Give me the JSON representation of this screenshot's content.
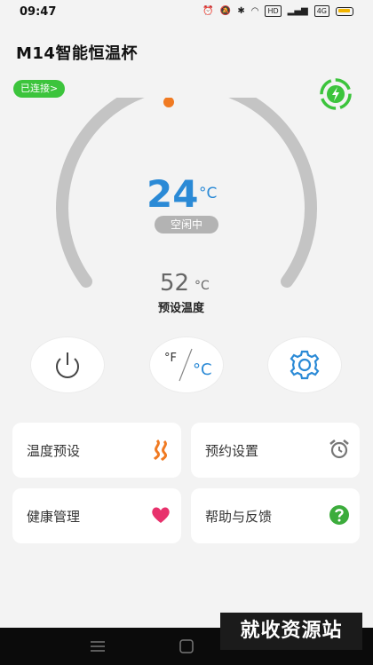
{
  "status_bar": {
    "time": "09:47",
    "hd_label": "HD",
    "net_label": "4G"
  },
  "header": {
    "title": "M14智能恒温杯",
    "connection_label": "已连接>"
  },
  "gauge": {
    "current_temp": "24",
    "current_unit": "°C",
    "state": "空闲中",
    "preset_temp": "52",
    "preset_unit": "°C",
    "preset_label": "预设温度",
    "indicator_color": "#f07a22",
    "track_color": "#c4c4c4"
  },
  "controls": {
    "unit_f": "°F",
    "unit_c": "°C"
  },
  "cards": {
    "temp_preset": "温度预设",
    "schedule": "预约设置",
    "health": "健康管理",
    "help": "帮助与反馈"
  },
  "watermark": "就收资源站",
  "colors": {
    "accent_blue": "#2b8ad6",
    "green": "#3cc43c",
    "orange": "#f07a22",
    "pink": "#e8316c"
  }
}
